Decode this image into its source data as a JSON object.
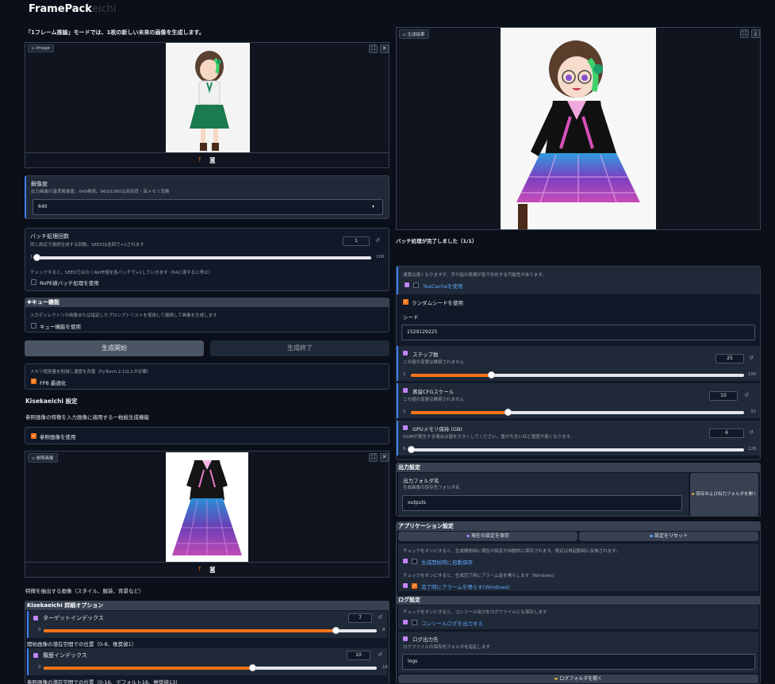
{
  "app": {
    "title": "FramePack",
    "title_ghost": "eichi"
  },
  "left": {
    "mode_note": "「1フレーム推論」モードでは、1枚の新しい未来の画像を生成します。",
    "image_tag": "Image",
    "resolution": {
      "label": "解像度",
      "desc": "出力画像の基準解像度。640推奨。960/1080は高負荷・高メモリ消費",
      "value": "640"
    },
    "batch": {
      "label": "バッチ処理回数",
      "desc": "同じ設定で連続生成する回数。SEEDは各回で+1されます",
      "value": "1",
      "min": "1",
      "max": "100",
      "pct": 0
    },
    "batch_note": "チェックすると、SEEDではなくRoPE値を各バッチで+1していきます（64に達すると停止）",
    "rope_label": "RoPE値バッチ処理を使用",
    "queue": {
      "header": "キュー機能",
      "desc": "入力ディレクトリの画像または指定したプロンプトリストを使用して連続して画像を生成します",
      "label": "キュー機能を使用"
    },
    "start_button": "生成開始",
    "stop_button": "生成終了",
    "memory": {
      "desc": "メモリ使用量を削減し速度を改善（PyTorch 2.1以上が必要）",
      "label": "FP8 最適化"
    },
    "kisekae_title": "Kisekaeichi 設定",
    "kisekae_desc": "参照画像の特徴を入力画像に適用する一枚絵生成機能",
    "use_ref_label": "参照画像を使用",
    "ref_tag": "参照画像",
    "ref_note": "特徴を抽出する画像（スタイル、服装、背景など）",
    "detail_header": "Kisekaeichi 詳細オプション",
    "target_index": {
      "label": "ターゲットインデックス",
      "value": "7",
      "min": "0",
      "max": "8",
      "pct": 0.875
    },
    "start_pos_note": "開始画像の潜在空間での位置（0-8、推奨値1）",
    "history_index": {
      "label": "履歴インデックス",
      "value": "10",
      "min": "0",
      "max": "16",
      "pct": 0.625
    },
    "ref_pos_note": "参照画像の潜在空間での位置（0-16、デフォルト16、推奨値13）"
  },
  "right": {
    "result_tag": "生成結果",
    "batch_done": "バッチ処理が完了しました（1/1）",
    "teacache_note": "速度は速くなりますが、手や指の表現が若干劣化する可能性があります。",
    "teacache_label": "TeaCacheを使用",
    "random_seed_label": "ランダムシードを使用",
    "seed_label": "シード",
    "seed_value": "1529129225",
    "steps": {
      "label": "ステップ数",
      "desc": "この値の変更は推奨されません",
      "value": "25",
      "min": "1",
      "max": "100",
      "pct": 0.24
    },
    "cfg": {
      "label": "蒸留CFGスケール",
      "desc": "この値の変更は推奨されません",
      "value": "10",
      "min": "1",
      "max": "32",
      "pct": 0.29
    },
    "gpu": {
      "label": "GPUメモリ保持 (GB)",
      "desc": "OOMが発生する場合は値を大きくしてください。値が大きいほど速度が遅くなります。",
      "value": "6",
      "min": "6",
      "max": "128",
      "pct": 0
    },
    "output_header": "出力設定",
    "output_folder_label": "出力フォルダ名",
    "output_folder_desc": "生成画像の保存先フォルダ名",
    "output_folder_value": "outputs",
    "open_folder_button": "保存および出力フォルダを開く",
    "app_settings_header": "アプリケーション設定",
    "save_settings_button": "現在の設定を保存",
    "reset_settings_button": "設定をリセット",
    "autosave_note": "チェックをオンにすると、生成開始時に現在の設定が自動的に保存されます。設定は再起動時に反映されます。",
    "autosave_label": "生成開始時に自動保存",
    "alarm_note": "チェックをオンにすると、生成完了時にアラーム音を鳴らします（Windows）",
    "alarm_label": "完了時にアラームを鳴らす(Windows)",
    "log_header": "ログ設定",
    "log_note": "チェックをオンにすると、コンソール出力をログファイルにも保存します",
    "console_log_label": "コンソールログを出力する",
    "log_dir_label": "ログ出力先",
    "log_dir_desc": "ログファイルの保存先フォルダを指定します",
    "log_dir_value": "logs",
    "open_log_button": "ログフォルダを開く"
  }
}
